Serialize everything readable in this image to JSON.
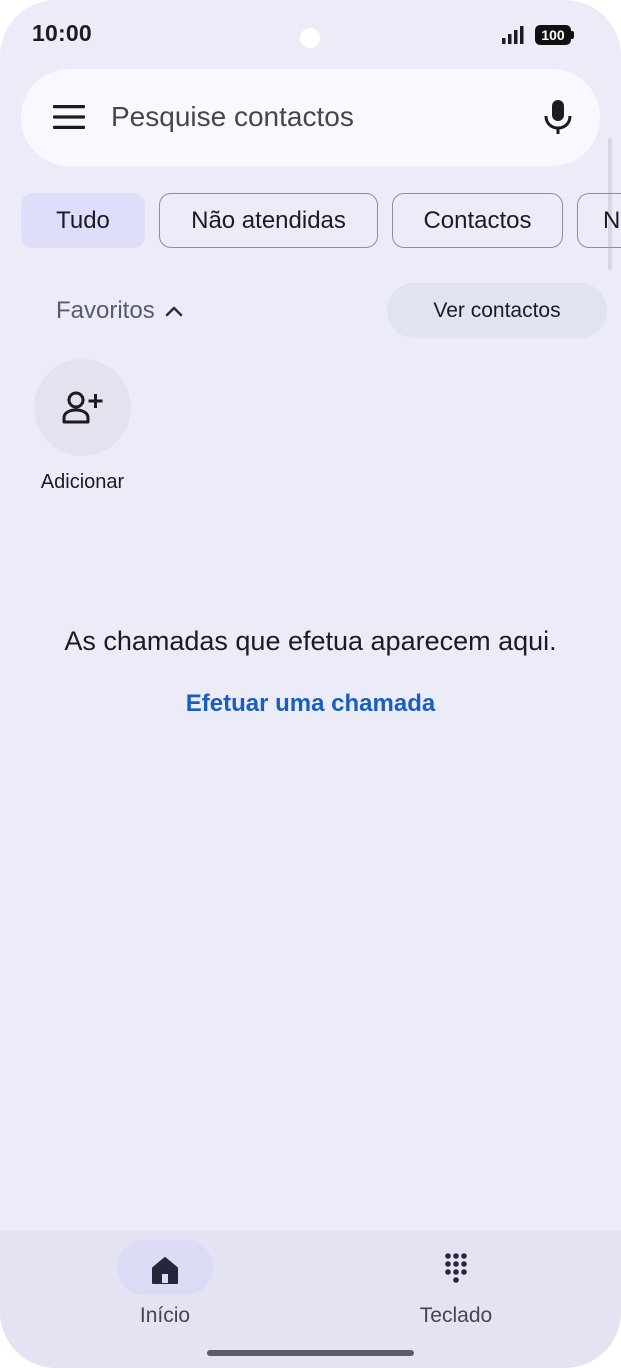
{
  "status_bar": {
    "time": "10:00",
    "battery": "100",
    "icons": [
      "signal-icon",
      "battery-icon"
    ]
  },
  "search": {
    "placeholder": "Pesquise contactos",
    "icons": [
      "menu-icon",
      "mic-icon"
    ]
  },
  "filters": {
    "chips": [
      "Tudo",
      "Não atendidas",
      "Contactos",
      "N"
    ],
    "selected": "Tudo"
  },
  "favorites": {
    "title": "Favoritos",
    "view_contacts_label": "Ver contactos",
    "add_label": "Adicionar"
  },
  "empty_state": {
    "message": "As chamadas que efetua aparecem aqui.",
    "action": "Efetuar uma chamada"
  },
  "bottom_nav": {
    "items": [
      {
        "label": "Início",
        "icon": "home-icon",
        "selected": true
      },
      {
        "label": "Teclado",
        "icon": "dialpad-icon",
        "selected": false
      }
    ]
  },
  "colors": {
    "background": "#ecebf8",
    "accent_link": "#1a5fbf",
    "selected_chip": "#dfdefa"
  }
}
